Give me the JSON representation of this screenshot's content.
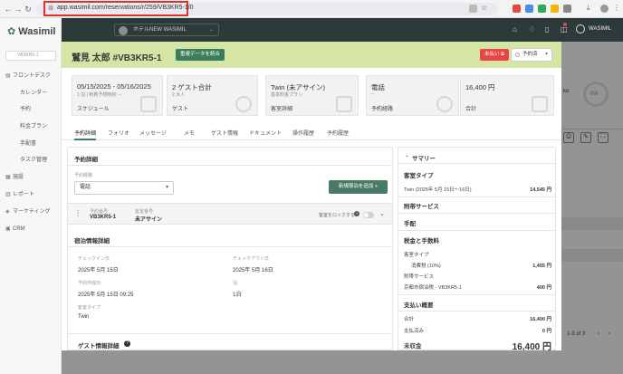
{
  "browser": {
    "url": "app.wasimil.com/reservations/r/259/VB3KR5-1/0"
  },
  "app": {
    "logo": "Wasimil",
    "search_placeholder": "VB3KR5-1",
    "hotel": "ホテルNEW WASIMIL",
    "user": "WASIMIL"
  },
  "sidebar": {
    "items": [
      {
        "label": "フロントデスク",
        "icon": "frontdesk-icon"
      },
      {
        "label": "カレンダー"
      },
      {
        "label": "予約"
      },
      {
        "label": "料金プラン"
      },
      {
        "label": "手配書"
      },
      {
        "label": "タスク管理"
      },
      {
        "label": "施設",
        "icon": "building-icon"
      },
      {
        "label": "レポート",
        "icon": "report-icon"
      },
      {
        "label": "マーケティング",
        "icon": "marketing-icon"
      },
      {
        "label": "CRM",
        "icon": "crm-icon"
      }
    ]
  },
  "background": {
    "pager": "1-3 of 3",
    "badge_text": "ko",
    "percent": "0%"
  },
  "modal": {
    "title": "鷲見 太郎 #VB3KR5-1",
    "merge_button": "重複データを統合",
    "unpaid_badge": "未払い",
    "status": "予約済",
    "cards": [
      {
        "line1": "05/15/2025 - 05/16/2025",
        "line2": "1 泊 | 到着予想時刻: --",
        "line3": "スケジュール"
      },
      {
        "line1": "2 ゲスト合計",
        "line2": "2 大人",
        "line3": "ゲスト"
      },
      {
        "line1": "Twin (未アサイン)",
        "line2": "基本料金プラン",
        "line3": "客室詳細"
      },
      {
        "line1": "電話",
        "line2": "--",
        "line3": "予約経路"
      },
      {
        "line1": "16,400 円",
        "line2": "",
        "line3": "合計"
      }
    ],
    "tabs": [
      "予約詳細",
      "フォリオ",
      "メッセージ",
      "メモ",
      "ゲスト情報",
      "ドキュメント",
      "操作履歴",
      "予約履歴"
    ],
    "left": {
      "section_title": "予約詳細",
      "route_label": "予約経路",
      "route_value": "電話",
      "add_room_button": "新規宿泊を追加",
      "reservation_no_label": "予約番号:",
      "reservation_no": "VB3KR5-1",
      "room_no_label": "客室番号:",
      "room_no": "未アサイン",
      "lock_label": "客室をロックする",
      "stay_title": "宿泊情報詳細",
      "checkin_label": "チェックイン日",
      "checkin": "2025年 5月 15日",
      "checkout_label": "チェックアウト日",
      "checkout": "2025年 5月 16日",
      "created_label": "予約作成日:",
      "created": "2025年 5月 15日 09:25",
      "nights_label": "泊",
      "nights": "1泊",
      "roomtype_label": "客室タイプ",
      "roomtype": "Twin",
      "guest_title": "ゲスト情報詳細"
    },
    "summary": {
      "title": "サマリー",
      "roomtype_head": "客室タイプ",
      "room_line": "Twin (2025年 5月 15日〜16日)",
      "room_amount": "14,545 円",
      "addon_head": "附帯サービス",
      "arrange_head": "手配",
      "tax_head": "税金と手数料",
      "tax_room": "客室タイプ",
      "tax_consumption": "消費税 (10%)",
      "tax_consumption_amount": "1,455 円",
      "addon2": "附帯サービス",
      "city_tax": "京都市宿泊税 - VB3KR5-1",
      "city_tax_amount": "400 円",
      "payment_head": "支払い概要",
      "total_label": "合計",
      "total": "16,400 円",
      "paid_label": "支払済み",
      "paid": "0 円",
      "balance_label": "未収金",
      "balance": "16,400 円"
    }
  }
}
